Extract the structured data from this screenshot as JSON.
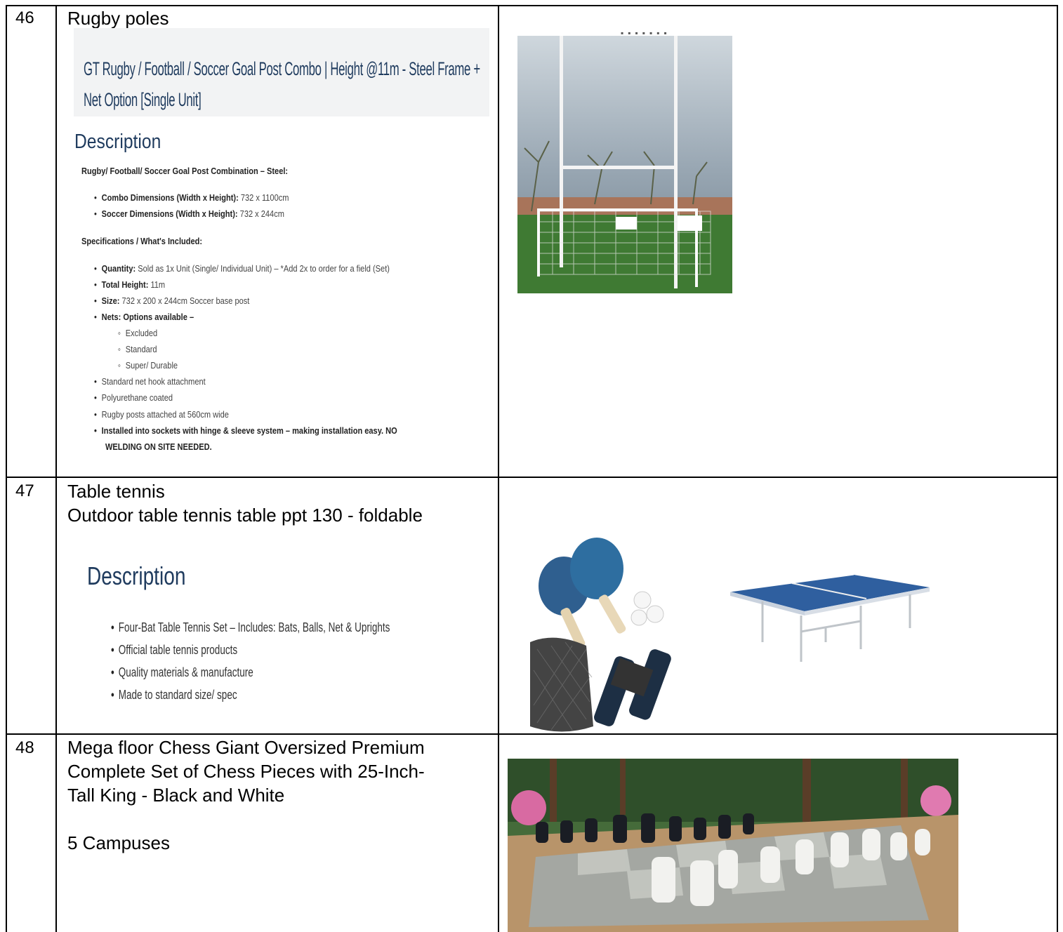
{
  "rows": [
    {
      "number": "46",
      "title": "Rugby poles",
      "product_heading": "GT Rugby / Football / Soccer Goal Post Combo | Height @11m - Steel Frame + Net Option [Single Unit]",
      "description_heading": "Description",
      "intro": "Rugby/ Football/ Soccer Goal Post Combination – Steel:",
      "dimensions": [
        {
          "label": "Combo Dimensions (Width x Height):",
          "value": " 732 x 1100cm"
        },
        {
          "label": "Soccer Dimensions (Width x Height):",
          "value": " 732 x 244cm"
        }
      ],
      "specs_heading": "Specifications / What's Included:",
      "specs": [
        {
          "label": "Quantity:",
          "value": " Sold as 1x Unit (Single/ Individual Unit) – *Add 2x to order for a field (Set)"
        },
        {
          "label": "Total Height:",
          "value": " 11m"
        },
        {
          "label": "Size:",
          "value": " 732 x 200 x 244cm Soccer base post"
        },
        {
          "label": "Nets: Options available –",
          "value": ""
        }
      ],
      "net_options": [
        "Excluded",
        "Standard",
        "Super/ Durable"
      ],
      "extras": [
        "Standard net hook attachment",
        "Polyurethane coated",
        "Rugby posts attached at 560cm wide"
      ],
      "install_note_line1": "Installed into sockets with hinge & sleeve system – making installation easy. NO",
      "install_note_line2": "WELDING ON SITE NEEDED."
    },
    {
      "number": "47",
      "title": "Table tennis\nOutdoor table tennis table ppt 130 - foldable",
      "description_heading": "Description",
      "bullets": [
        "Four-Bat Table Tennis Set – Includes: Bats, Balls, Net & Uprights",
        "Official table tennis products",
        "Quality materials & manufacture",
        "Made to standard size/ spec"
      ]
    },
    {
      "number": "48",
      "title": "Mega floor Chess Giant Oversized Premium\nComplete Set of Chess Pieces with 25-Inch-\nTall King - Black and White\n\n5 Campuses"
    }
  ],
  "colors": {
    "heading_blue": "#1f3b5e",
    "net_blue": "#2f5f8f",
    "grass": "#3f7a33"
  }
}
